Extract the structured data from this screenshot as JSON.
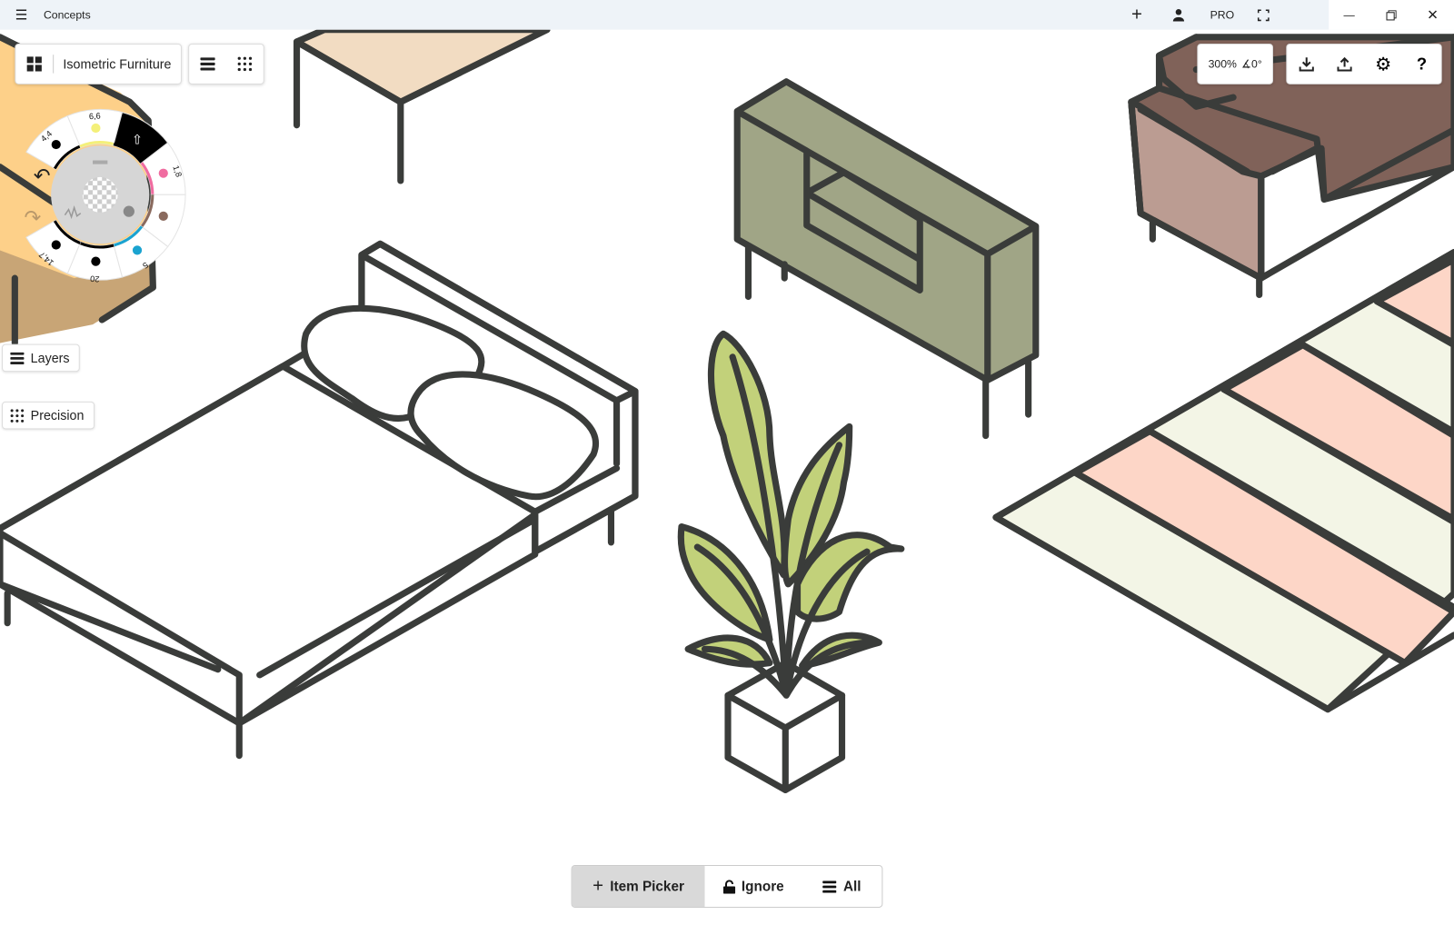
{
  "titlebar": {
    "app_title": "Concepts",
    "pro_label": "PRO",
    "icons": [
      "hamburger-menu-icon",
      "plus-icon",
      "user-icon",
      "fullscreen-icon",
      "minimize-icon",
      "restore-icon",
      "close-icon"
    ]
  },
  "toolbar": {
    "project_name": "Isometric Furniture",
    "zoom": "300%",
    "rotation": "∡0°",
    "actions": [
      "download-icon",
      "upload-icon",
      "settings-icon",
      "help-icon"
    ]
  },
  "tool_wheel": {
    "segments": [
      {
        "label": "4,4",
        "color": "#000000",
        "tool": "pen"
      },
      {
        "label": "6,6",
        "color": "#f4f07a",
        "tool": "marker"
      },
      {
        "label": "",
        "color": "#000000",
        "tool": "selection",
        "active": true
      },
      {
        "label": "1,8",
        "color": "#f06ca0",
        "tool": "airbrush"
      },
      {
        "label": "",
        "color": "#8a6a5e",
        "tool": "fill"
      },
      {
        "label": "5",
        "color": "#1aa3d0",
        "tool": "pencil"
      },
      {
        "label": "20",
        "color": "#000000",
        "tool": "soft-brush"
      },
      {
        "label": "14,7",
        "color": "#000000",
        "tool": "eraser"
      }
    ]
  },
  "side": {
    "layers_label": "Layers",
    "precision_label": "Precision"
  },
  "bottom_bar": {
    "item_picker": "Item Picker",
    "ignore": "Ignore",
    "all": "All",
    "active": "Item Picker"
  },
  "colors": {
    "stroke": "#3a3c3a",
    "orange": "#fdd089",
    "beige": "#f2dcc2",
    "olive": "#a0a586",
    "sofa_light": "#bb9c92",
    "sofa_dark": "#806259",
    "plant": "#c2d17a",
    "rug_pink": "#fdd6c7",
    "rug_cream": "#f3f5e6"
  }
}
